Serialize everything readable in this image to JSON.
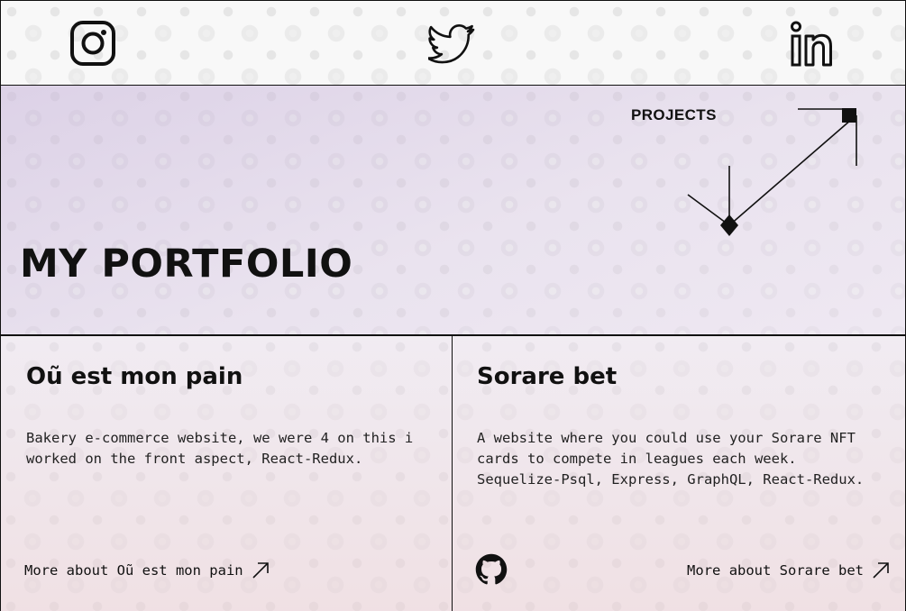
{
  "social": {
    "instagram_icon": "instagram-icon",
    "twitter_icon": "twitter-icon",
    "linkedin_icon": "linkedin-icon"
  },
  "hero": {
    "title": "MY PORTFOLIO",
    "projects_link": "PROJECTS",
    "graphic_icon": "arrow-graphic-icon"
  },
  "projects": [
    {
      "title": "Oũ est mon pain",
      "description": "Bakery e-commerce website, we were 4 on this i worked on the front aspect, React-Redux.",
      "link_label": "More about Oũ est mon pain"
    },
    {
      "title": "Sorare bet",
      "description": "A website where you could use your Sorare NFT cards to compete in leagues each week. Sequelize-Psql, Express, GraphQL, React-Redux.",
      "link_label": "More about Sorare bet",
      "repo_icon": "github-icon"
    }
  ],
  "colors": {
    "ink": "#111111",
    "hero_tint": "#e2d8ea",
    "card_tint": "#ecd6da"
  }
}
